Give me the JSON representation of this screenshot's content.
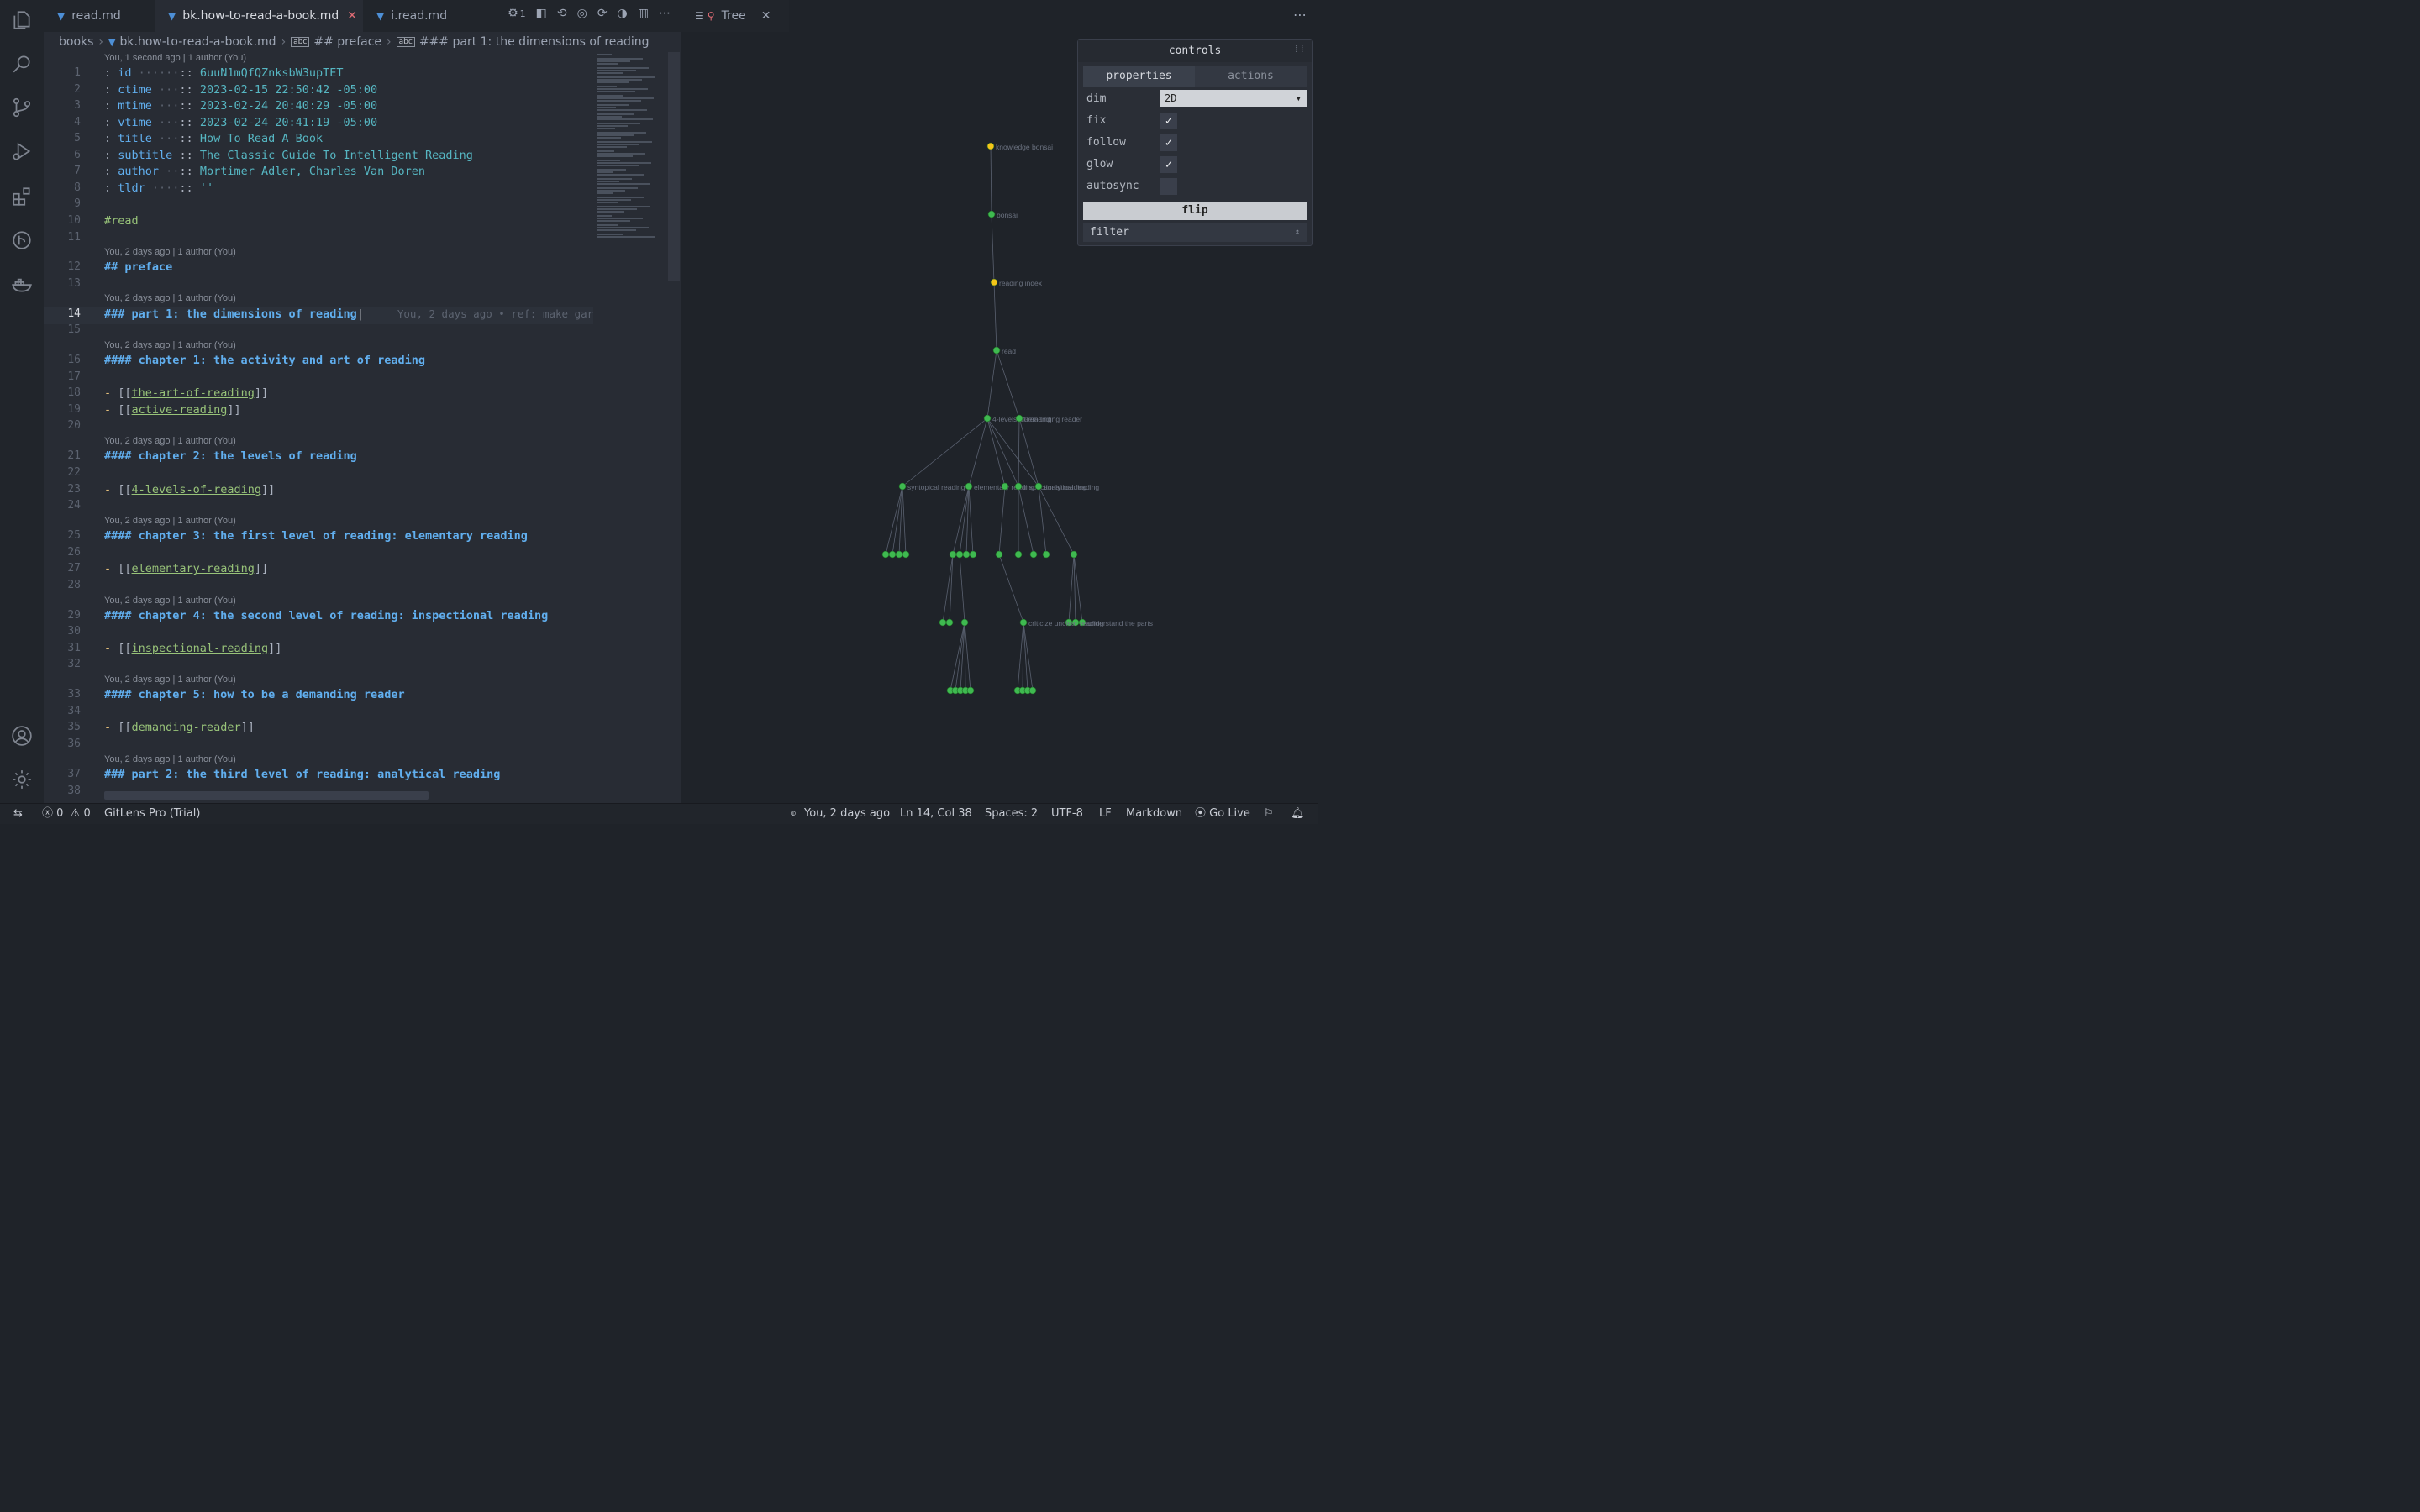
{
  "tabs": [
    {
      "label": "read.md",
      "active": false
    },
    {
      "label": "bk.how-to-read-a-book.md",
      "active": true
    },
    {
      "label": "i.read.md",
      "active": false
    }
  ],
  "tab_actions": {
    "gear_count": "1"
  },
  "breadcrumb": {
    "folder": "books",
    "file": "bk.how-to-read-a-book.md",
    "section1": "## preface",
    "section2": "### part 1: the dimensions of reading"
  },
  "blame": {
    "top": "You, 1 second ago | 1 author (You)",
    "days": "You, 2 days ago | 1 author (You)",
    "inline": "You, 2 days ago • ref: make gar"
  },
  "lines": [
    {
      "n": "1",
      "k": "id",
      "pad": " ······",
      "v": "6uuN1mQfQZnksbW3upTET"
    },
    {
      "n": "2",
      "k": "ctime",
      "pad": " ···",
      "v": "2023-02-15 22:50:42 -05:00"
    },
    {
      "n": "3",
      "k": "mtime",
      "pad": " ···",
      "v": "2023-02-24 20:40:29 -05:00"
    },
    {
      "n": "4",
      "k": "vtime",
      "pad": " ···",
      "v": "2023-02-24 20:41:19 -05:00"
    },
    {
      "n": "5",
      "k": "title",
      "pad": " ···",
      "v": "How To Read A Book"
    },
    {
      "n": "6",
      "k": "subtitle",
      "pad": " ",
      "v": "The Classic Guide To Intelligent Reading"
    },
    {
      "n": "7",
      "k": "author",
      "pad": " ··",
      "v": "Mortimer Adler, Charles Van Doren"
    },
    {
      "n": "8",
      "k": "tldr",
      "pad": " ····",
      "v": "''"
    }
  ],
  "content": {
    "tag": "#read",
    "preface": "## preface",
    "part1": "### part 1: the dimensions of reading",
    "ch1": "#### chapter 1: the activity and art of reading",
    "link_art": "the-art-of-reading",
    "link_active": "active-reading",
    "ch2": "#### chapter 2: the levels of reading",
    "link_levels": "4-levels-of-reading",
    "ch3": "#### chapter 3: the first level of reading: elementary reading",
    "link_elem": "elementary-reading",
    "ch4": "#### chapter 4: the second level of reading: inspectional reading",
    "link_insp": "inspectional-reading",
    "ch5": "#### chapter 5: how to be a demanding reader",
    "link_dem": "demanding-reader",
    "part2": "### part 2: the third level of reading: analytical reading"
  },
  "right_panel": {
    "tab_label": "Tree"
  },
  "graph_labels": {
    "n1": "knowledge bonsai",
    "n2": "bonsai",
    "n3": "reading index",
    "n4": "read",
    "n5a": "4-levels-of-reading",
    "n5b": "demanding reader",
    "n6a": "syntopical reading",
    "n6b": "elementary reading",
    "n6c": "inspectional reading",
    "n6d": "analytical reading",
    "n8a": "criticize unclear reading",
    "n8b": "understand the parts"
  },
  "controls": {
    "title": "controls",
    "tab_properties": "properties",
    "tab_actions": "actions",
    "dim_label": "dim",
    "dim_value": "2D",
    "fix_label": "fix",
    "follow_label": "follow",
    "glow_label": "glow",
    "autosync_label": "autosync",
    "fix_checked": true,
    "follow_checked": true,
    "glow_checked": true,
    "autosync_checked": false,
    "flip_label": "flip",
    "filter_label": "filter"
  },
  "status": {
    "errors": "0",
    "warnings": "0",
    "gitlens": "GitLens Pro (Trial)",
    "blame": "You, 2 days ago",
    "position": "Ln 14, Col 38",
    "spaces": "Spaces: 2",
    "encoding": "UTF-8",
    "eol": "LF",
    "language": "Markdown",
    "golive": "Go Live"
  },
  "colors": {
    "accent": "#61afef",
    "link": "#98c379",
    "node": "#3fb950",
    "node_yellow": "#f5c518"
  }
}
